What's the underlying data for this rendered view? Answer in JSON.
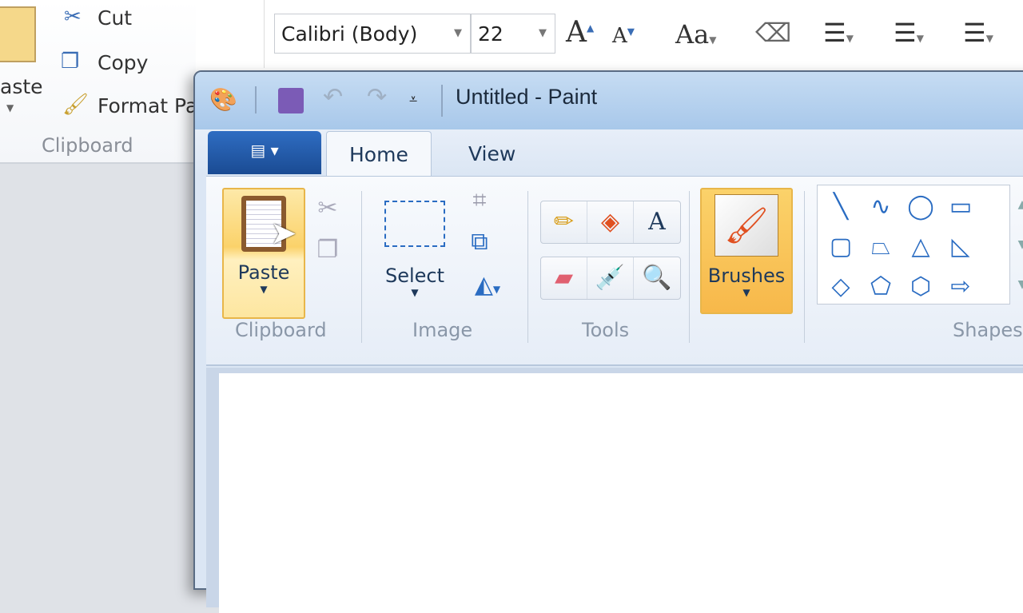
{
  "word": {
    "clipboard": {
      "paste_label": "aste",
      "cut_label": "Cut",
      "copy_label": "Copy",
      "format_painter_label": "Format Pa",
      "group_label": "Clipboard"
    },
    "font": {
      "family": "Calibri (Body)",
      "size": "22"
    },
    "grow_font": "A",
    "shrink_font": "A",
    "change_case": "Aa"
  },
  "paint": {
    "title": "Untitled - Paint",
    "tabs": [
      {
        "label": "Home",
        "active": true
      },
      {
        "label": "View",
        "active": false
      }
    ],
    "clipboard": {
      "paste_label": "Paste",
      "group_label": "Clipboard"
    },
    "image": {
      "select_label": "Select",
      "group_label": "Image"
    },
    "tools": {
      "group_label": "Tools",
      "text_tool": "A"
    },
    "brushes": {
      "label": "Brushes"
    },
    "shapes": {
      "group_label": "Shapes"
    }
  },
  "colors": {
    "accent": "#fbd26a",
    "file_button": "#1a4b93",
    "title_bar": "#b5d0ee"
  }
}
